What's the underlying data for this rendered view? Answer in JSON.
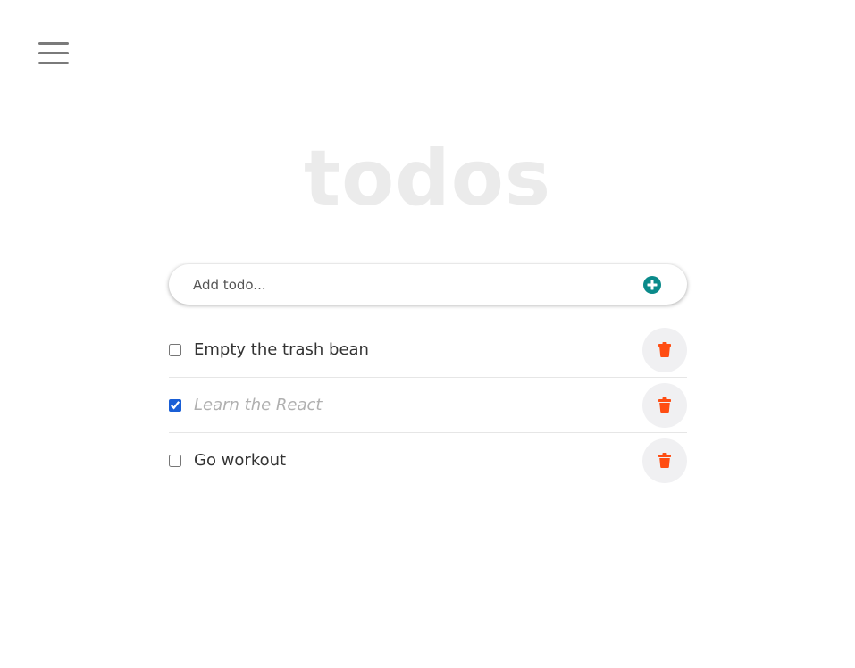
{
  "app": {
    "title": "todos"
  },
  "menu": {
    "icon": "hamburger-menu-icon"
  },
  "add_todo": {
    "placeholder": "Add todo...",
    "value": "",
    "button_icon": "plus-circle-icon",
    "accent_color": "#0a8a8a"
  },
  "todos": [
    {
      "text": "Empty the trash bean",
      "completed": false
    },
    {
      "text": "Learn the React",
      "completed": true
    },
    {
      "text": "Go workout",
      "completed": false
    }
  ],
  "delete": {
    "icon": "trash-icon",
    "color": "#ff4d12"
  }
}
